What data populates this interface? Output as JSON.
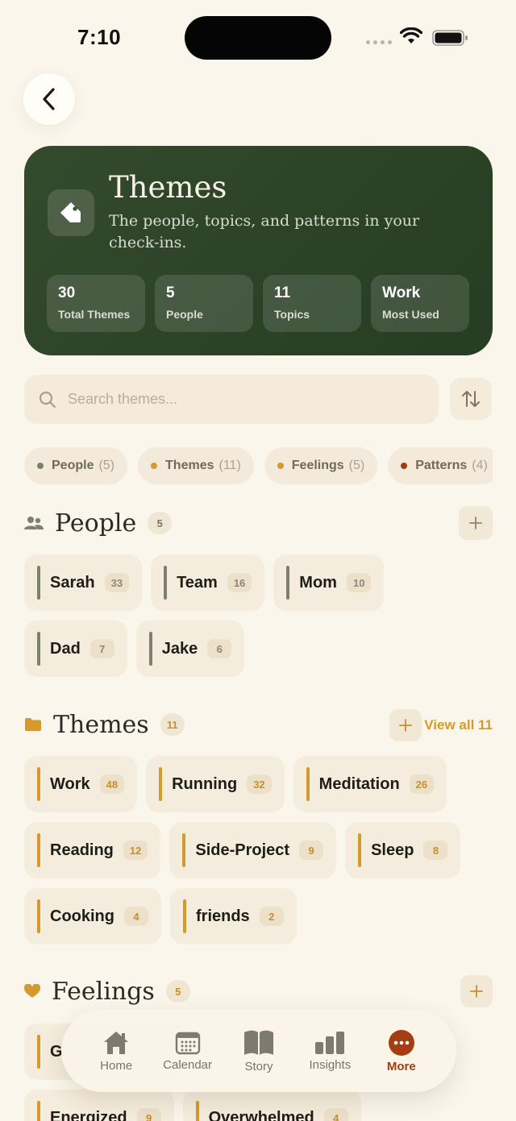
{
  "status": {
    "time": "7:10"
  },
  "header": {
    "title": "Themes",
    "subtitle": "The people, topics, and patterns in your check-ins.",
    "stats": [
      {
        "value": "30",
        "label": "Total Themes"
      },
      {
        "value": "5",
        "label": "People"
      },
      {
        "value": "11",
        "label": "Topics"
      },
      {
        "value": "Work",
        "label": "Most Used"
      }
    ]
  },
  "search": {
    "placeholder": "Search themes..."
  },
  "filters": [
    {
      "label": "People",
      "count": "(5)",
      "color": "#7d7f72"
    },
    {
      "label": "Themes",
      "count": "(11)",
      "color": "#d59a2e"
    },
    {
      "label": "Feelings",
      "count": "(5)",
      "color": "#d59a2e"
    },
    {
      "label": "Patterns",
      "count": "(4)",
      "color": "#9e3e12"
    }
  ],
  "people": {
    "title": "People",
    "count": "5",
    "accent": "#7d7f72",
    "items": [
      {
        "name": "Sarah",
        "count": "33"
      },
      {
        "name": "Team",
        "count": "16"
      },
      {
        "name": "Mom",
        "count": "10"
      },
      {
        "name": "Dad",
        "count": "7"
      },
      {
        "name": "Jake",
        "count": "6"
      }
    ]
  },
  "themes": {
    "title": "Themes",
    "count": "11",
    "view_all": "View all 11",
    "accent": "#d59a2e",
    "items": [
      {
        "name": "Work",
        "count": "48"
      },
      {
        "name": "Running",
        "count": "32"
      },
      {
        "name": "Meditation",
        "count": "26"
      },
      {
        "name": "Reading",
        "count": "12"
      },
      {
        "name": "Side-Project",
        "count": "9"
      },
      {
        "name": "Sleep",
        "count": "8"
      },
      {
        "name": "Cooking",
        "count": "4"
      },
      {
        "name": "friends",
        "count": "2"
      }
    ]
  },
  "feelings": {
    "title": "Feelings",
    "count": "5",
    "accent": "#d59a2e",
    "items": [
      {
        "name": "G",
        "count": ""
      },
      {
        "name": "Energized",
        "count": "9"
      },
      {
        "name": "Overwhelmed",
        "count": "4"
      }
    ]
  },
  "tabbar": {
    "items": [
      {
        "label": "Home",
        "icon": "home-icon"
      },
      {
        "label": "Calendar",
        "icon": "calendar-icon"
      },
      {
        "label": "Story",
        "icon": "book-icon"
      },
      {
        "label": "Insights",
        "icon": "bar-chart-icon"
      },
      {
        "label": "More",
        "icon": "more-icon",
        "active": true
      }
    ],
    "active_color": "#9e3e12"
  }
}
